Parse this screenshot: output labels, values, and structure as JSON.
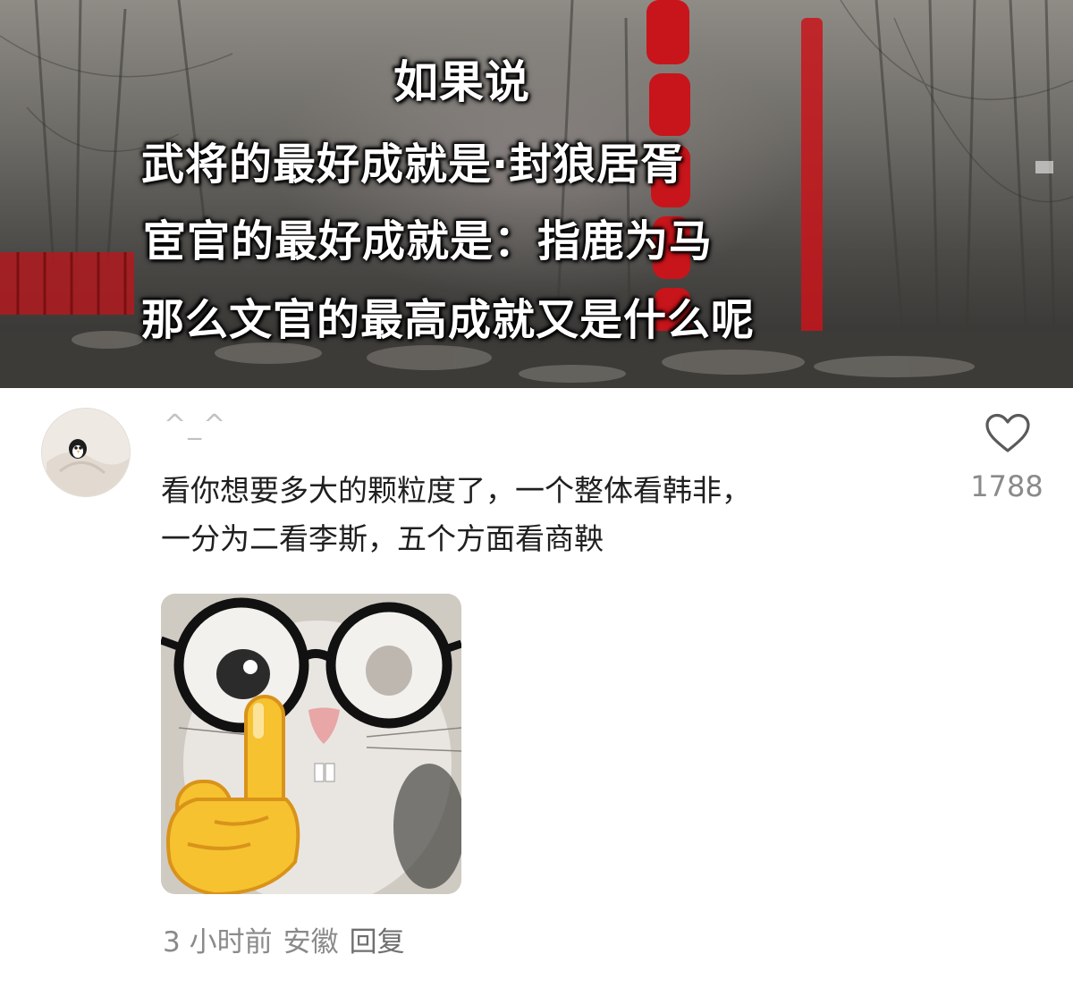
{
  "video": {
    "overlay_lines": [
      "如果说",
      "武将的最好成就是·封狼居胥",
      "宦官的最好成就是：指鹿为马",
      "那么文官的最高成就又是什么呢"
    ]
  },
  "comment": {
    "username": "^_^",
    "text_lines": [
      "看你想要多大的颗粒度了，一个整体看韩非，",
      "一分为二看李斯，五个方面看商鞅"
    ],
    "like_icon": "heart-outline-icon",
    "like_count": "1788",
    "sticker": "cat-with-glasses-finger-sticker",
    "time": "3 小时前",
    "location": "安徽",
    "reply_label": "回复"
  },
  "colors": {
    "text_primary": "#1f1f1f",
    "text_secondary": "#8a8a8a",
    "lantern_red": "#c8151b"
  }
}
